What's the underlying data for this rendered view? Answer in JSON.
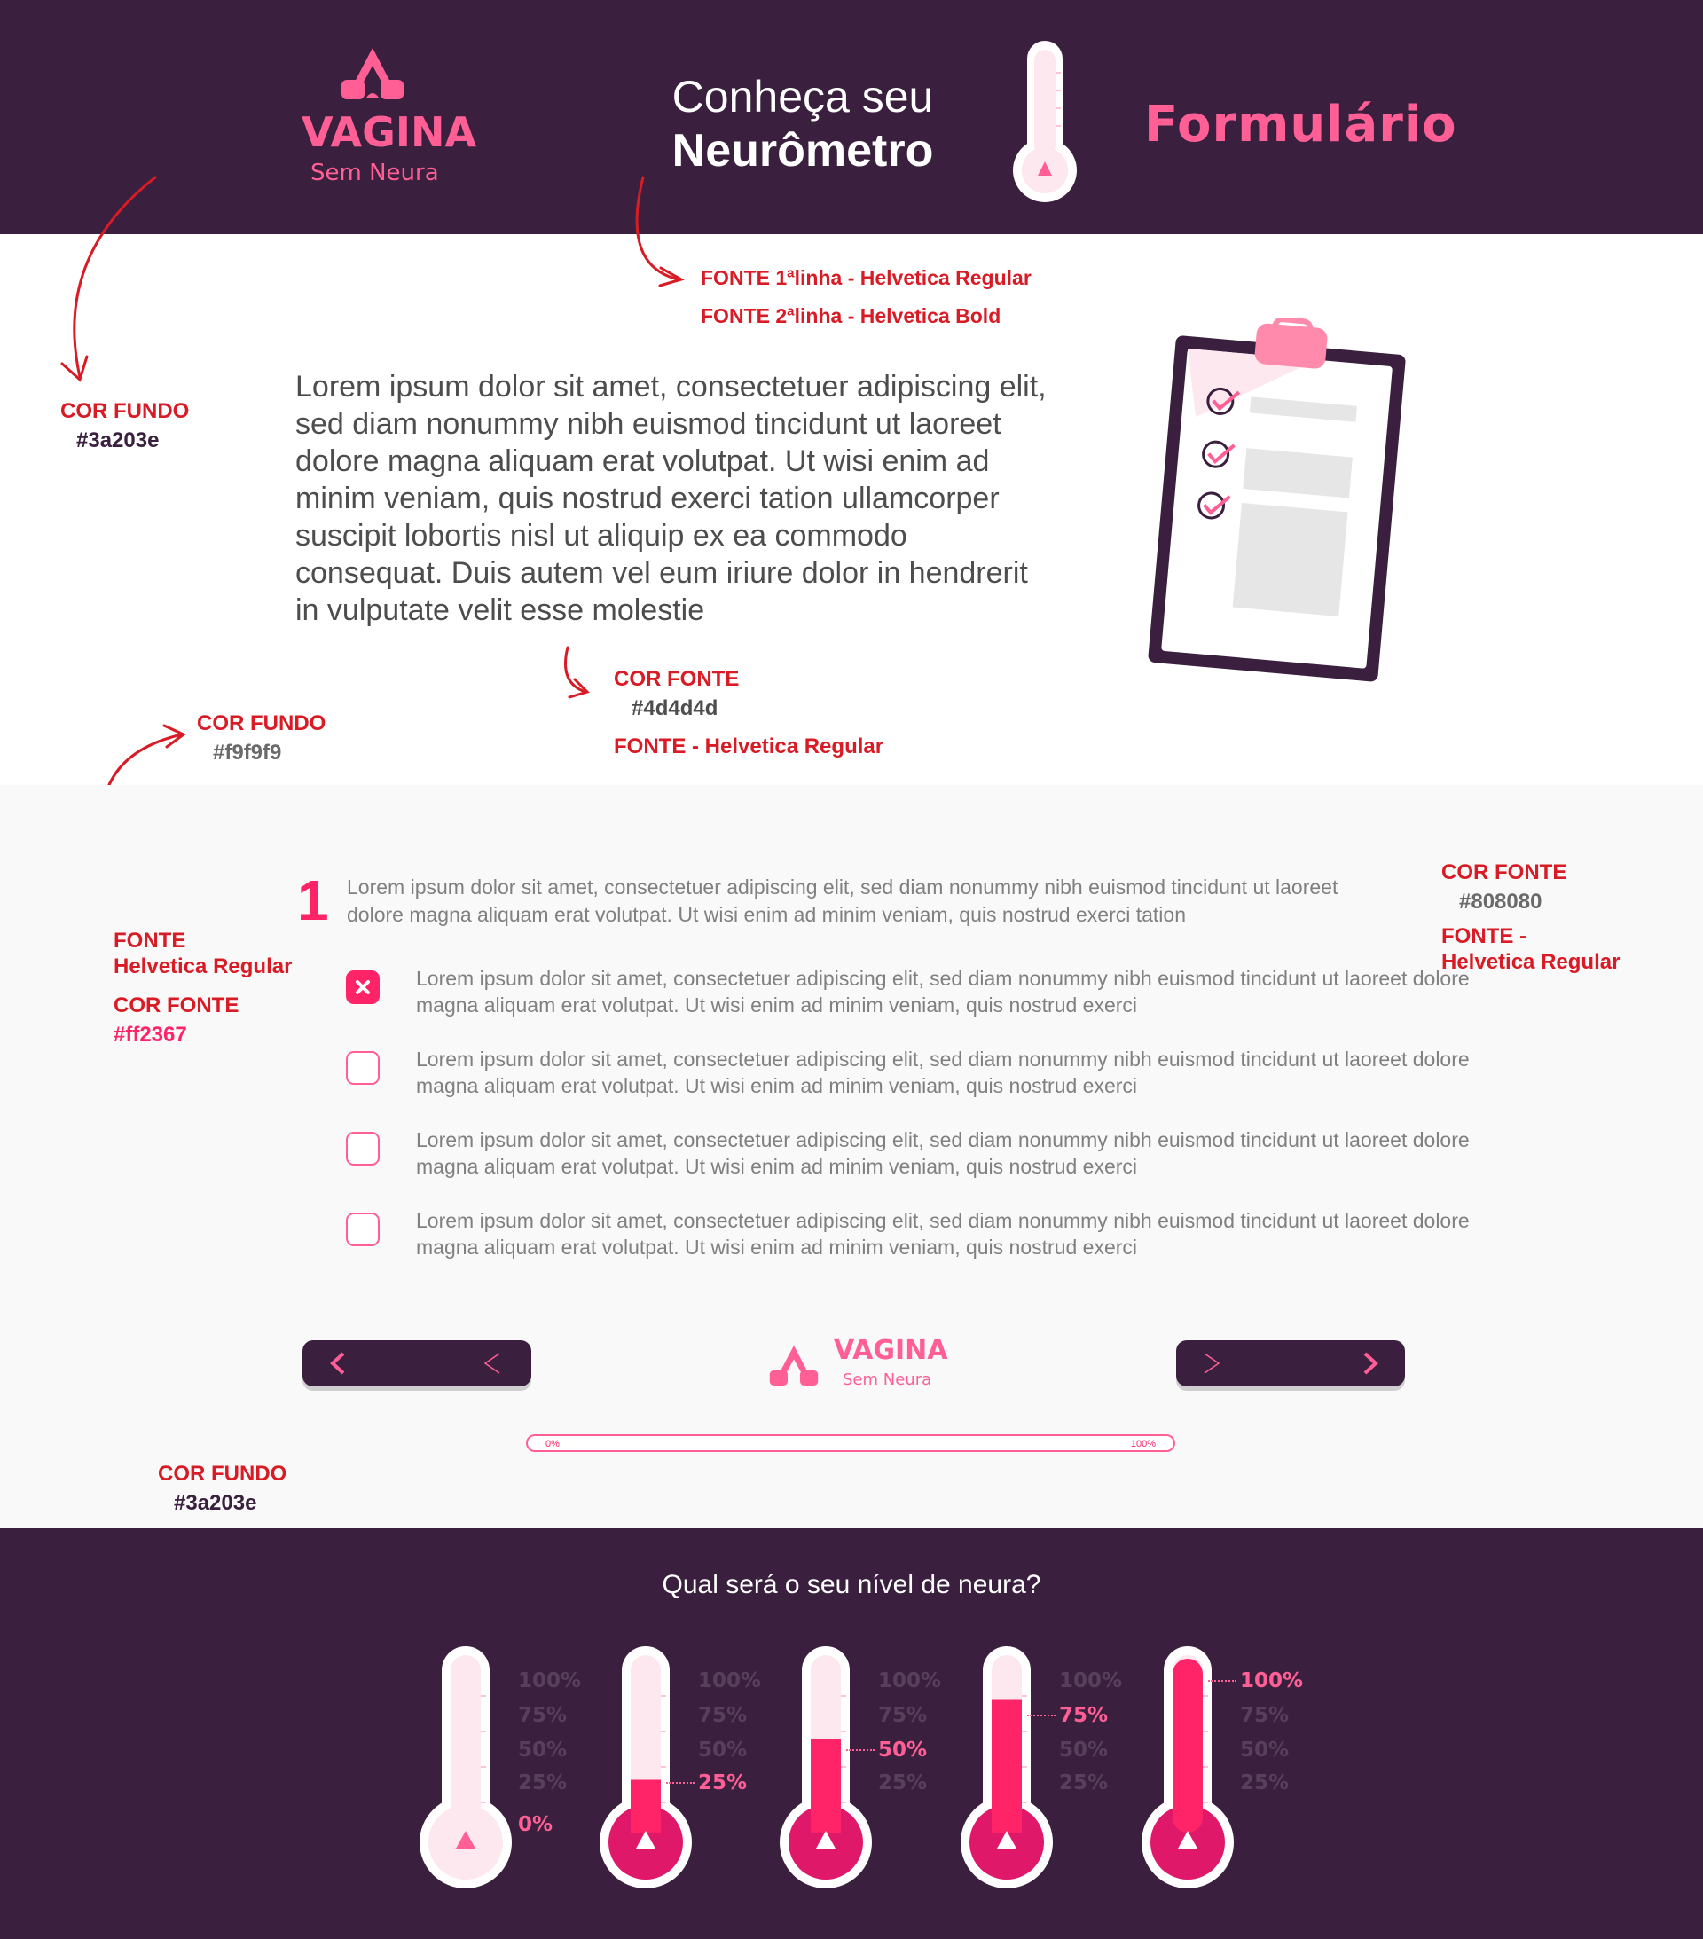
{
  "header": {
    "logo": {
      "word": "VAGINA",
      "sub": "Sem Neura"
    },
    "title_line1": "Conheça seu",
    "title_line2": "Neurômetro",
    "section_title": "Formulário"
  },
  "annotations": {
    "header_font_line1": "FONTE 1ªlinha - Helvetica Regular",
    "header_font_line2": "FONTE 2ªlinha - Helvetica Bold",
    "header_bg_label": "COR FUNDO",
    "header_bg_value": "#3a203e",
    "lead_color_label": "COR FONTE",
    "lead_color_value": "#4d4d4d",
    "lead_font": "FONTE - Helvetica Regular",
    "form_bg_label": "COR FUNDO",
    "form_bg_value": "#f9f9f9",
    "num_font_label": "FONTE",
    "num_font_value": "Helvetica Regular",
    "num_color_label": "COR FONTE",
    "num_color_value": "#ff2367",
    "q_color_label": "COR FONTE",
    "q_color_value": "#808080",
    "q_font_label": "FONTE -",
    "q_font_value": "Helvetica Regular",
    "footer_bg_label": "COR FUNDO",
    "footer_bg_value": "#3a203e"
  },
  "intro": {
    "text": "Lorem ipsum dolor sit amet, consectetuer adipiscing elit, sed diam nonummy nibh euismod tincidunt ut laoreet dolore magna aliquam erat volutpat. Ut wisi enim ad minim veniam, quis nostrud exerci tation ullamcorper suscipit lobortis nisl ut aliquip ex ea commodo consequat. Duis autem vel eum iriure dolor in hendrerit in vulputate velit esse molestie"
  },
  "question": {
    "number": "1",
    "text": "Lorem ipsum dolor sit amet, consectetuer adipiscing elit, sed diam nonummy nibh euismod tincidunt ut laoreet dolore magna aliquam erat volutpat. Ut wisi enim ad minim veniam, quis nostrud exerci tation",
    "options": [
      {
        "text": "Lorem ipsum dolor sit amet, consectetuer adipiscing elit, sed diam nonummy nibh euismod tincidunt ut laoreet dolore magna aliquam erat volutpat. Ut wisi enim ad minim veniam, quis nostrud exerci",
        "checked": true
      },
      {
        "text": "Lorem ipsum dolor sit amet, consectetuer adipiscing elit, sed diam nonummy nibh euismod tincidunt ut laoreet dolore magna aliquam erat volutpat. Ut wisi enim ad minim veniam, quis nostrud exerci",
        "checked": false
      },
      {
        "text": "Lorem ipsum dolor sit amet, consectetuer adipiscing elit, sed diam nonummy nibh euismod tincidunt ut laoreet dolore magna aliquam erat volutpat. Ut wisi enim ad minim veniam, quis nostrud exerci",
        "checked": false
      },
      {
        "text": "Lorem ipsum dolor sit amet, consectetuer adipiscing elit, sed diam nonummy nibh euismod tincidunt ut laoreet dolore magna aliquam erat volutpat. Ut wisi enim ad minim veniam, quis nostrud exerci",
        "checked": false
      }
    ]
  },
  "progress": {
    "start_label": "0%",
    "end_label": "100%",
    "value": 0
  },
  "footer": {
    "question": "Qual será o seu nível de neura?",
    "scale_labels": [
      "100%",
      "75%",
      "50%",
      "25%"
    ],
    "thermometers": [
      {
        "level": 0,
        "label": "0%"
      },
      {
        "level": 25,
        "label": "25%"
      },
      {
        "level": 50,
        "label": "50%"
      },
      {
        "level": 75,
        "label": "75%"
      },
      {
        "level": 100,
        "label": "100%"
      }
    ]
  },
  "colors": {
    "brand_dark": "#3a203e",
    "accent": "#ff2367",
    "accent_light": "#ff5f95",
    "text_gray": "#808080",
    "text_dark": "#4d4d4d",
    "form_bg": "#f9f9f9",
    "annotation_red": "#d81b24"
  }
}
